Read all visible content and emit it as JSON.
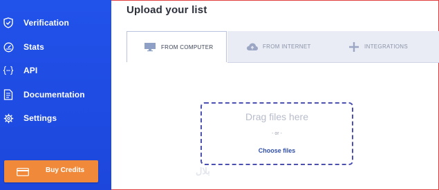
{
  "sidebar": {
    "items": [
      {
        "label": "Verification",
        "icon": "shield-check-icon",
        "active": true
      },
      {
        "label": "Stats",
        "icon": "gauge-icon"
      },
      {
        "label": "API",
        "icon": "braces-icon"
      },
      {
        "label": "Documentation",
        "icon": "document-icon"
      },
      {
        "label": "Settings",
        "icon": "gear-icon"
      }
    ],
    "buy_credits": {
      "label": "Buy Credits",
      "icon": "credit-card-icon"
    }
  },
  "main": {
    "title": "Upload your list",
    "tabs": [
      {
        "label": "FROM COMPUTER",
        "icon": "monitor-icon",
        "active": true
      },
      {
        "label": "FROM INTERNET",
        "icon": "cloud-icon"
      },
      {
        "label": "INTEGRATIONS",
        "icon": "plus-icon"
      }
    ],
    "dropzone": {
      "heading": "Drag files here",
      "or": "- or -",
      "choose": "Choose files"
    },
    "watermark": "بلال"
  },
  "colors": {
    "sidebar": "#1f4ee6",
    "buy_button": "#f08a3a",
    "dropzone_border": "#4b4fb0",
    "link": "#2f4ea8"
  }
}
